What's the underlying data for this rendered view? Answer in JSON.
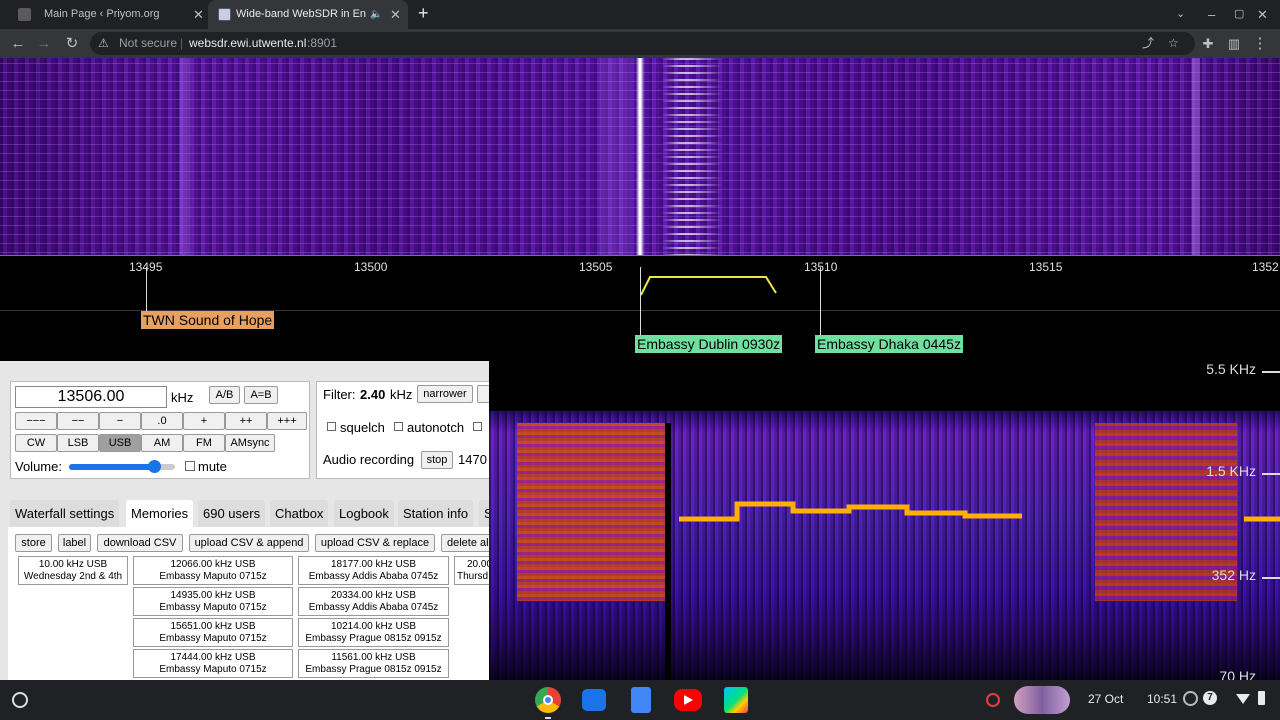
{
  "tabs": [
    {
      "title": "Main Page ‹ Priyom.org",
      "active": false
    },
    {
      "title": "Wide-band WebSDR in Ensch",
      "active": true
    }
  ],
  "omnibox": {
    "security": "Not secure",
    "host": "websdr.ewi.utwente.nl",
    "port": ":8901"
  },
  "scale": {
    "ticks": [
      "13495",
      "13500",
      "13505",
      "13510",
      "13515",
      "1352"
    ]
  },
  "stations": [
    {
      "label": "TWN Sound of Hope",
      "color": "#e8a060"
    },
    {
      "label": "Embassy Dublin 0930z",
      "color": "#70e0a0"
    },
    {
      "label": "Embassy Dhaka 0445z",
      "color": "#70e0a0"
    }
  ],
  "controls": {
    "frequency": "13506.00",
    "unit": "kHz",
    "ab": "A/B",
    "aeqb": "A=B",
    "steps": [
      "−−−",
      "−−",
      "−",
      ".0",
      "+",
      "++",
      "+++"
    ],
    "modes": [
      "CW",
      "LSB",
      "USB",
      "AM",
      "FM",
      "AMsync"
    ],
    "selected_mode": "USB",
    "volume_label": "Volume:",
    "volume_level": 0.8,
    "mute": "mute",
    "filter_label": "Filter:",
    "filter_value": "2.40",
    "filter_unit": "kHz",
    "narrower": "narrower",
    "squelch": "squelch",
    "autonotch": "autonotch",
    "audio_label": "Audio recording",
    "stop": "stop",
    "rec_value": "1470"
  },
  "panel_tabs": [
    "Waterfall settings",
    "Memories",
    "690 users",
    "Chatbox",
    "Logbook",
    "Station info",
    "S"
  ],
  "selected_panel_tab": "Memories",
  "memory_buttons": [
    "store",
    "label",
    "download CSV",
    "upload CSV & append",
    "upload CSV & replace",
    "delete al"
  ],
  "memories": {
    "col1": [
      [
        "10.00 kHz USB",
        "Wednesday 2nd & 4th"
      ]
    ],
    "col2": [
      [
        "12066.00 kHz USB",
        "Embassy Maputo 0715z"
      ],
      [
        "14935.00 kHz USB",
        "Embassy Maputo 0715z"
      ],
      [
        "15651.00 kHz USB",
        "Embassy Maputo 0715z"
      ],
      [
        "17444.00 kHz USB",
        "Embassy Maputo 0715z"
      ]
    ],
    "col3": [
      [
        "18177.00 kHz USB",
        "Embassy Addis Ababa 0745z"
      ],
      [
        "20334.00 kHz USB",
        "Embassy Addis Ababa 0745z"
      ],
      [
        "10214.00 kHz USB",
        "Embassy Prague 0815z 0915z"
      ],
      [
        "11561.00 kHz USB",
        "Embassy Prague 0815z 0915z"
      ]
    ],
    "col4": [
      [
        "20.00",
        "Thursd"
      ]
    ]
  },
  "spectrogram": {
    "labels": [
      "5.5 KHz",
      "1.5 KHz",
      "352 Hz",
      "70 Hz"
    ]
  },
  "taskbar": {
    "date": "27 Oct",
    "time": "10:51",
    "notif_count": "7"
  }
}
